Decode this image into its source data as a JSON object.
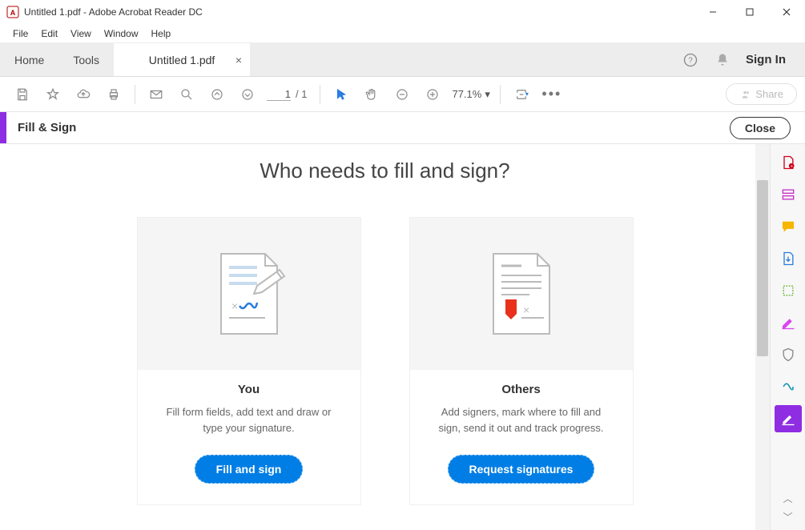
{
  "window": {
    "title": "Untitled 1.pdf - Adobe Acrobat Reader DC"
  },
  "menu": {
    "file": "File",
    "edit": "Edit",
    "view": "View",
    "window": "Window",
    "help": "Help"
  },
  "tabs": {
    "home": "Home",
    "tools": "Tools",
    "doc": "Untitled 1.pdf",
    "signin": "Sign In"
  },
  "toolbar": {
    "page_current": "1",
    "page_total": "/ 1",
    "zoom": "77.1%",
    "share": "Share"
  },
  "fsbar": {
    "title": "Fill & Sign",
    "close": "Close"
  },
  "main": {
    "heading": "Who needs to fill and sign?",
    "card_you": {
      "title": "You",
      "desc": "Fill form fields, add text and draw or type your signature.",
      "button": "Fill and sign"
    },
    "card_others": {
      "title": "Others",
      "desc": "Add signers, mark where to fill and sign, send it out and track progress.",
      "button": "Request signatures"
    }
  }
}
